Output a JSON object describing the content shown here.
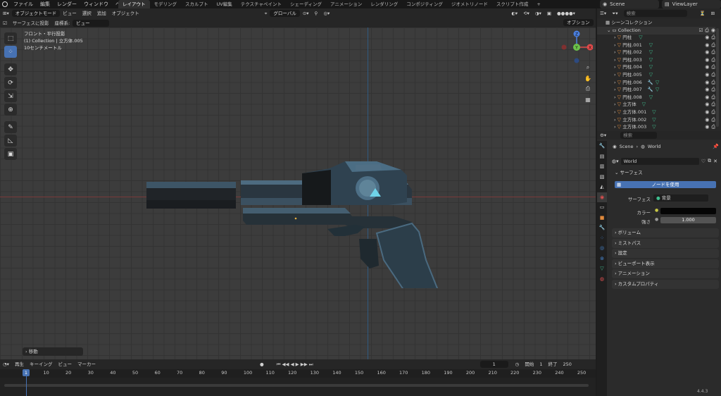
{
  "menu": [
    "ファイル",
    "編集",
    "レンダー",
    "ウィンドウ",
    "ヘルプ"
  ],
  "workspaces": [
    "レイアウト",
    "モデリング",
    "スカルプト",
    "UV編集",
    "テクスチャペイント",
    "シェーディング",
    "アニメーション",
    "レンダリング",
    "コンポジティング",
    "ジオメトリノード",
    "スクリプト作成"
  ],
  "workspace_add": "+",
  "scene_name": "Scene",
  "view_layer": "ViewLayer",
  "viewport_header": {
    "mode": "オブジェクトモード",
    "items": [
      "ビュー",
      "選択",
      "追加",
      "オブジェクト"
    ],
    "transform": "グローバル"
  },
  "viewport_header2": {
    "snap_surface": "サーフェスに投影",
    "orient_label": "座標系:",
    "orient_value": "ビュー"
  },
  "options_label": "オプション",
  "viewport_info": [
    "フロント・平行投影",
    "(1) Collection | 立方体.005",
    "10センチメートル"
  ],
  "last_operator": "移動",
  "gizmo_axes": [
    "X",
    "Y",
    "Z"
  ],
  "timeline": {
    "menus": [
      "再生",
      "キーイング",
      "ビュー",
      "マーカー"
    ],
    "current_frame": "1",
    "start_label": "開始",
    "start": "1",
    "end_label": "終了",
    "end": "250"
  },
  "ruler_ticks": [
    "1",
    "10",
    "20",
    "30",
    "40",
    "50",
    "60",
    "70",
    "80",
    "90",
    "100",
    "110",
    "120",
    "130",
    "140",
    "150",
    "160",
    "170",
    "180",
    "190",
    "200",
    "210",
    "220",
    "230",
    "240",
    "250"
  ],
  "outliner": {
    "search_placeholder": "検索",
    "root": "シーンコレクション",
    "collection": "Collection",
    "items": [
      "円柱",
      "円柱.001",
      "円柱.002",
      "円柱.003",
      "円柱.004",
      "円柱.005",
      "円柱.006",
      "円柱.007",
      "円柱.008",
      "立方体",
      "立方体.001",
      "立方体.002",
      "立方体.003"
    ]
  },
  "properties": {
    "search_placeholder": "検索",
    "breadcrumb_scene": "Scene",
    "breadcrumb_world": "World",
    "world_name": "World",
    "surface_panel": "サーフェス",
    "use_nodes_button": "ノードを使用",
    "surface_label": "サーフェス",
    "surface_value": "背景",
    "color_label": "カラー",
    "strength_label": "強さ",
    "strength_value": "1.000",
    "panels": [
      "ボリューム",
      "ミストパス",
      "設定",
      "ビューポート表示",
      "アニメーション",
      "カスタムプロパティ"
    ]
  },
  "version": "4.4.3",
  "colors": {
    "accent": "#4772b3",
    "x_axis": "#e04a4a",
    "y_axis": "#6cc24a",
    "z_axis": "#4a7fe0"
  }
}
